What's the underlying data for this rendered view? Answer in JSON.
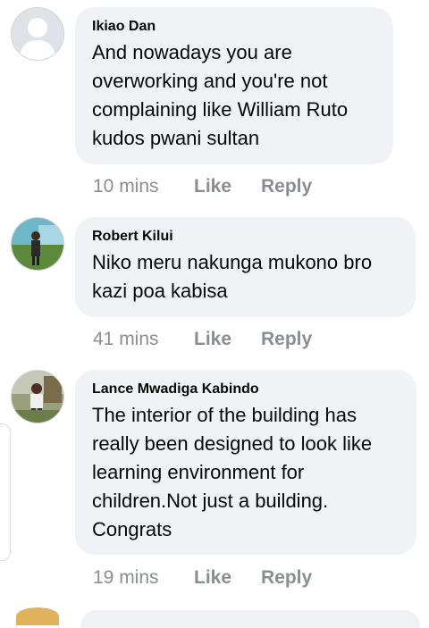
{
  "comments": [
    {
      "author": "Ikiao Dan",
      "text": "And nowadays you are overworking and you're not complaining like William Ruto kudos pwani sultan",
      "time": "10 mins",
      "like": "Like",
      "reply": "Reply"
    },
    {
      "author": "Robert Kilui",
      "text": "Niko meru nakunga mukono bro kazi poa kabisa",
      "time": "41 mins",
      "like": "Like",
      "reply": "Reply"
    },
    {
      "author": "Lance Mwadiga Kabindo",
      "text": "The interior of the building has really been designed to look like learning environment for children.Not just a building. Congrats",
      "time": "19 mins",
      "like": "Like",
      "reply": "Reply"
    }
  ],
  "colors": {
    "bubble": "#f0f2f5",
    "meta_text": "#8a8d91",
    "primary_text": "#050505"
  }
}
